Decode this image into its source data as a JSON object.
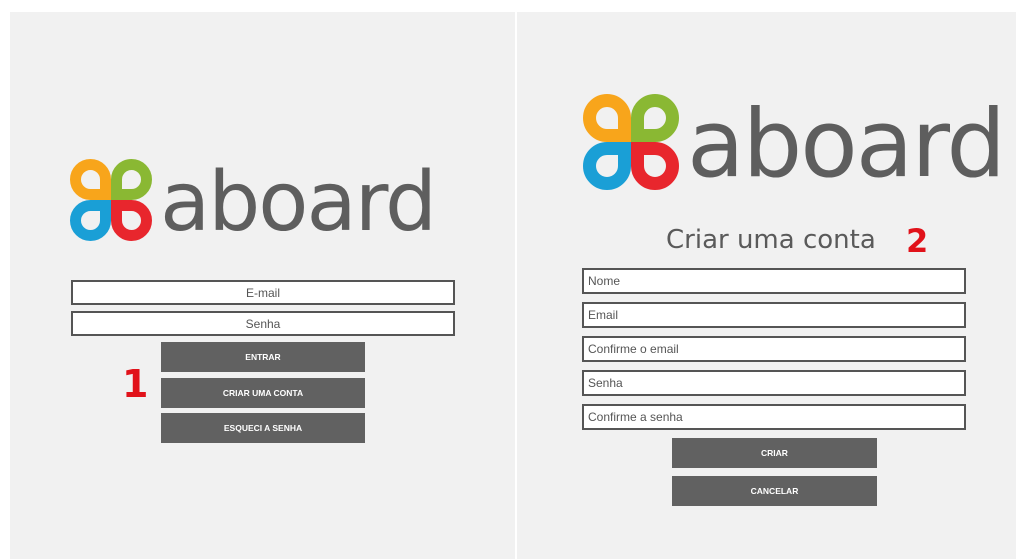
{
  "brand": {
    "name": "aboard",
    "colors": {
      "orange": "#f8a51b",
      "green": "#8ab833",
      "blue": "#1a9fd6",
      "red": "#e8262d",
      "text": "#5e5e5e"
    }
  },
  "login": {
    "step": "1",
    "email_placeholder": "E-mail",
    "password_placeholder": "Senha",
    "enter_label": "ENTRAR",
    "create_account_label": "CRIAR UMA CONTA",
    "forgot_password_label": "ESQUECI A SENHA"
  },
  "signup": {
    "step": "2",
    "title": "Criar uma conta",
    "name_placeholder": "Nome",
    "email_placeholder": "Email",
    "confirm_email_placeholder": "Confirme o email",
    "password_placeholder": "Senha",
    "confirm_password_placeholder": "Confirme a senha",
    "create_label": "CRIAR",
    "cancel_label": "CANCELAR"
  }
}
